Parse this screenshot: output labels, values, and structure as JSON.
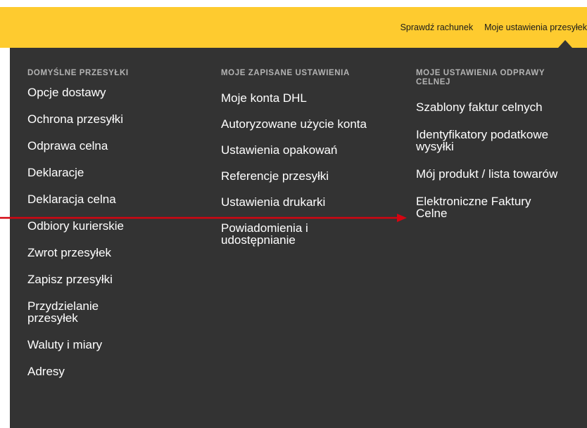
{
  "header": {
    "check_account": "Sprawdź rachunek",
    "shipping_settings": "Moje ustawienia przesyłek"
  },
  "menu": {
    "col1": {
      "heading": "DOMYŚLNE PRZESYŁKI",
      "items": [
        "Opcje dostawy",
        "Ochrona przesyłki",
        "Odprawa celna",
        "Deklaracje",
        "Deklaracja celna",
        "Odbiory kurierskie",
        "Zwrot przesyłek",
        "Zapisz przesyłki",
        "Przydzielanie przesyłek",
        "Waluty i miary",
        "Adresy"
      ]
    },
    "col2": {
      "heading": "MOJE ZAPISANE USTAWIENIA",
      "items": [
        "Moje konta DHL",
        "Autoryzowane użycie konta",
        "Ustawienia opakowań",
        "Referencje przesyłki",
        "Ustawienia drukarki",
        "Powiadomienia i udostępnianie"
      ]
    },
    "col3": {
      "heading": "MOJE USTAWIENIA ODPRAWY CELNEJ",
      "items": [
        "Szablony faktur celnych",
        "Identyfikatory podatkowe wysyłki",
        "Mój produkt / lista towarów",
        "Elektroniczne Faktury Celne"
      ]
    }
  },
  "colors": {
    "header_bg": "#fecb2f",
    "menu_bg": "#333333",
    "heading_text": "#b3b3b3",
    "item_text": "#ffffff",
    "annotation_arrow": "#d40511"
  },
  "icons": {
    "annotation": "red-arrow-icon",
    "caret": "caret-up-icon"
  }
}
